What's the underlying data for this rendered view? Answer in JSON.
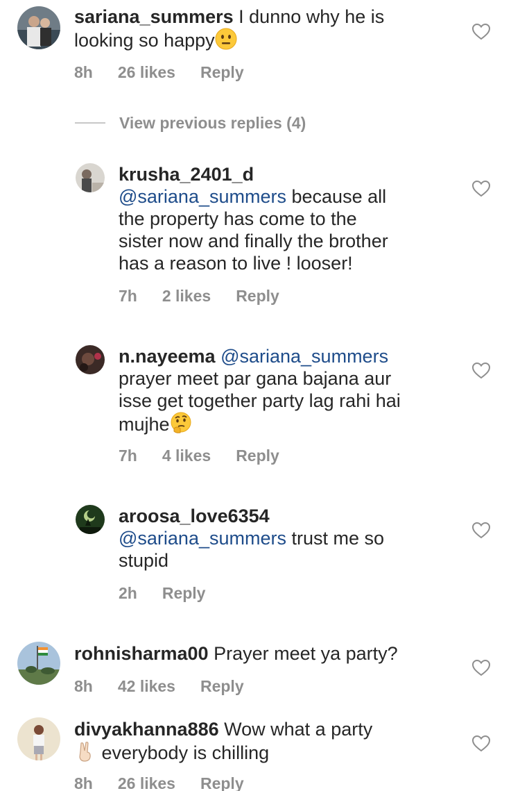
{
  "view_previous_replies": "View previous replies (4)",
  "comments": [
    {
      "username": "sariana_summers",
      "text_line1": " I dunno why he is",
      "text_line2": "looking so happy",
      "time": "8h",
      "likes": "26 likes",
      "reply": "Reply"
    },
    {
      "username": "krusha_2401_d",
      "mention": "@sariana_summers",
      "text_line2": " because all",
      "text_line3": "the property has come to the",
      "text_line4": "sister now and finally the brother",
      "text_line5": "has a reason to live ! looser!",
      "time": "7h",
      "likes": "2 likes",
      "reply": "Reply"
    },
    {
      "username": "n.nayeema",
      "mention": " @sariana_summers",
      "text_line2": "prayer meet par gana bajana aur",
      "text_line3": "isse get together party lag rahi hai",
      "text_line4": "mujhe",
      "time": "7h",
      "likes": "4 likes",
      "reply": "Reply"
    },
    {
      "username": "aroosa_love6354",
      "mention": "@sariana_summers",
      "text_line2": " trust me so",
      "text_line3": "stupid",
      "time": "2h",
      "reply": "Reply"
    },
    {
      "username": "rohnisharma00",
      "text_line1": " Prayer meet ya party?",
      "time": "8h",
      "likes": "42 likes",
      "reply": "Reply"
    },
    {
      "username": "divyakhanna886",
      "text_line1": " Wow what a party",
      "text_line2": " everybody is chilling",
      "time": "8h",
      "likes": "26 likes",
      "reply": "Reply"
    }
  ],
  "icons": {
    "like": "heart-outline-icon",
    "neutral_face": "neutral-face-emoji",
    "thinking_face": "thinking-face-emoji",
    "victory_hand": "victory-hand-emoji"
  },
  "colors": {
    "text": "#262626",
    "meta": "#8e8e8e",
    "mention": "#1e4c8a"
  }
}
